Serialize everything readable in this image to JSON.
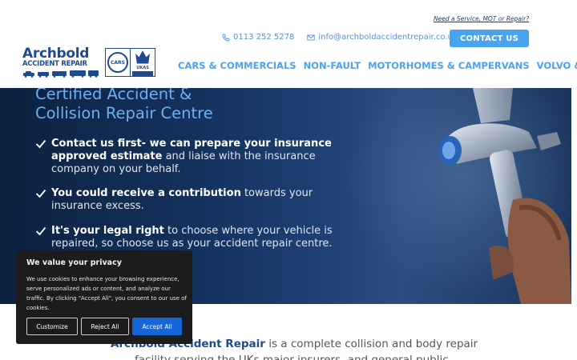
{
  "header": {
    "service_link": "Need a Service, MOT or Repair?",
    "phone": "0113 252 5278",
    "email": "info@archboldaccidentrepair.co.uk",
    "contact_button": "CONTACT US",
    "logo": {
      "name": "Archbold",
      "sub": "ACCIDENT REPAIR",
      "badge_cars": "CARS",
      "badge_ukas": "UKAS"
    },
    "nav": [
      "CARS & COMMERCIALS",
      "NON-FAULT",
      "MOTORHOMES & CAMPERVANS",
      "VOLVO & FO"
    ]
  },
  "hero": {
    "title_line1": "Certified Accident &",
    "title_line2": "Collision Repair Centre",
    "bullets": [
      {
        "bold": "Contact us first- we can prepare your insurance approved estimate",
        "rest": " and liaise with the insurance company on your behalf."
      },
      {
        "bold": "You could receive a contribution",
        "rest": " towards your insurance excess."
      },
      {
        "bold": "It's your legal right",
        "rest": " to choose where your vehicle is repaired, so choose us as your accident repair centre."
      }
    ]
  },
  "intro": {
    "bold": "Archbold Accident Repair",
    "line1_rest": " is a complete collision and body repair",
    "line2": "facility serving the UKs major insurers, and general public"
  },
  "cookie": {
    "title": "We value your privacy",
    "text": "We use cookies to enhance your browsing experience, serve personalized ads or content, and analyze our traffic. By clicking \"Accept All\", you consent to our use of cookies.",
    "customize": "Customize",
    "reject": "Reject All",
    "accept": "Accept All"
  },
  "colors": {
    "brand_navy": "#1f4b8e",
    "accent_blue": "#4aa3ee",
    "accept_blue": "#1565d8"
  }
}
